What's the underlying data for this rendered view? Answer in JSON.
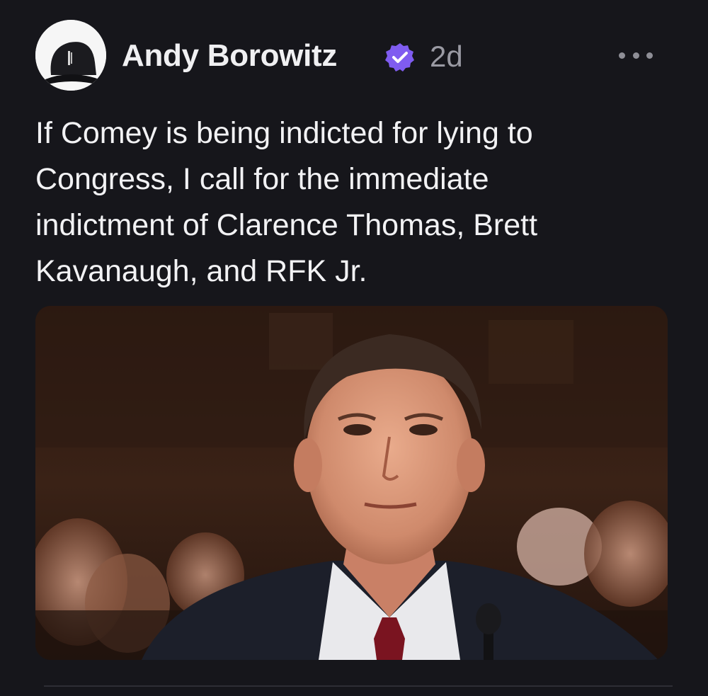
{
  "post": {
    "author": {
      "name": "Andy Borowitz",
      "avatar": "avatar-black-cap",
      "verified": true,
      "verified_color": "#7f5cf0"
    },
    "timestamp": "2d",
    "more_icon": "more-horizontal-icon",
    "text": "If Comey is being indicted for lying to\nCongress, I call for the immediate\nindictment of Clarence Thomas, Brett\nKavanaugh, and RFK Jr.",
    "image": {
      "subject": "man in dark suit and red tie seated before a microphone at a hearing"
    }
  },
  "colors": {
    "background": "#16161b",
    "text_primary": "#f2f2f4",
    "text_secondary": "#9a9aa3"
  }
}
